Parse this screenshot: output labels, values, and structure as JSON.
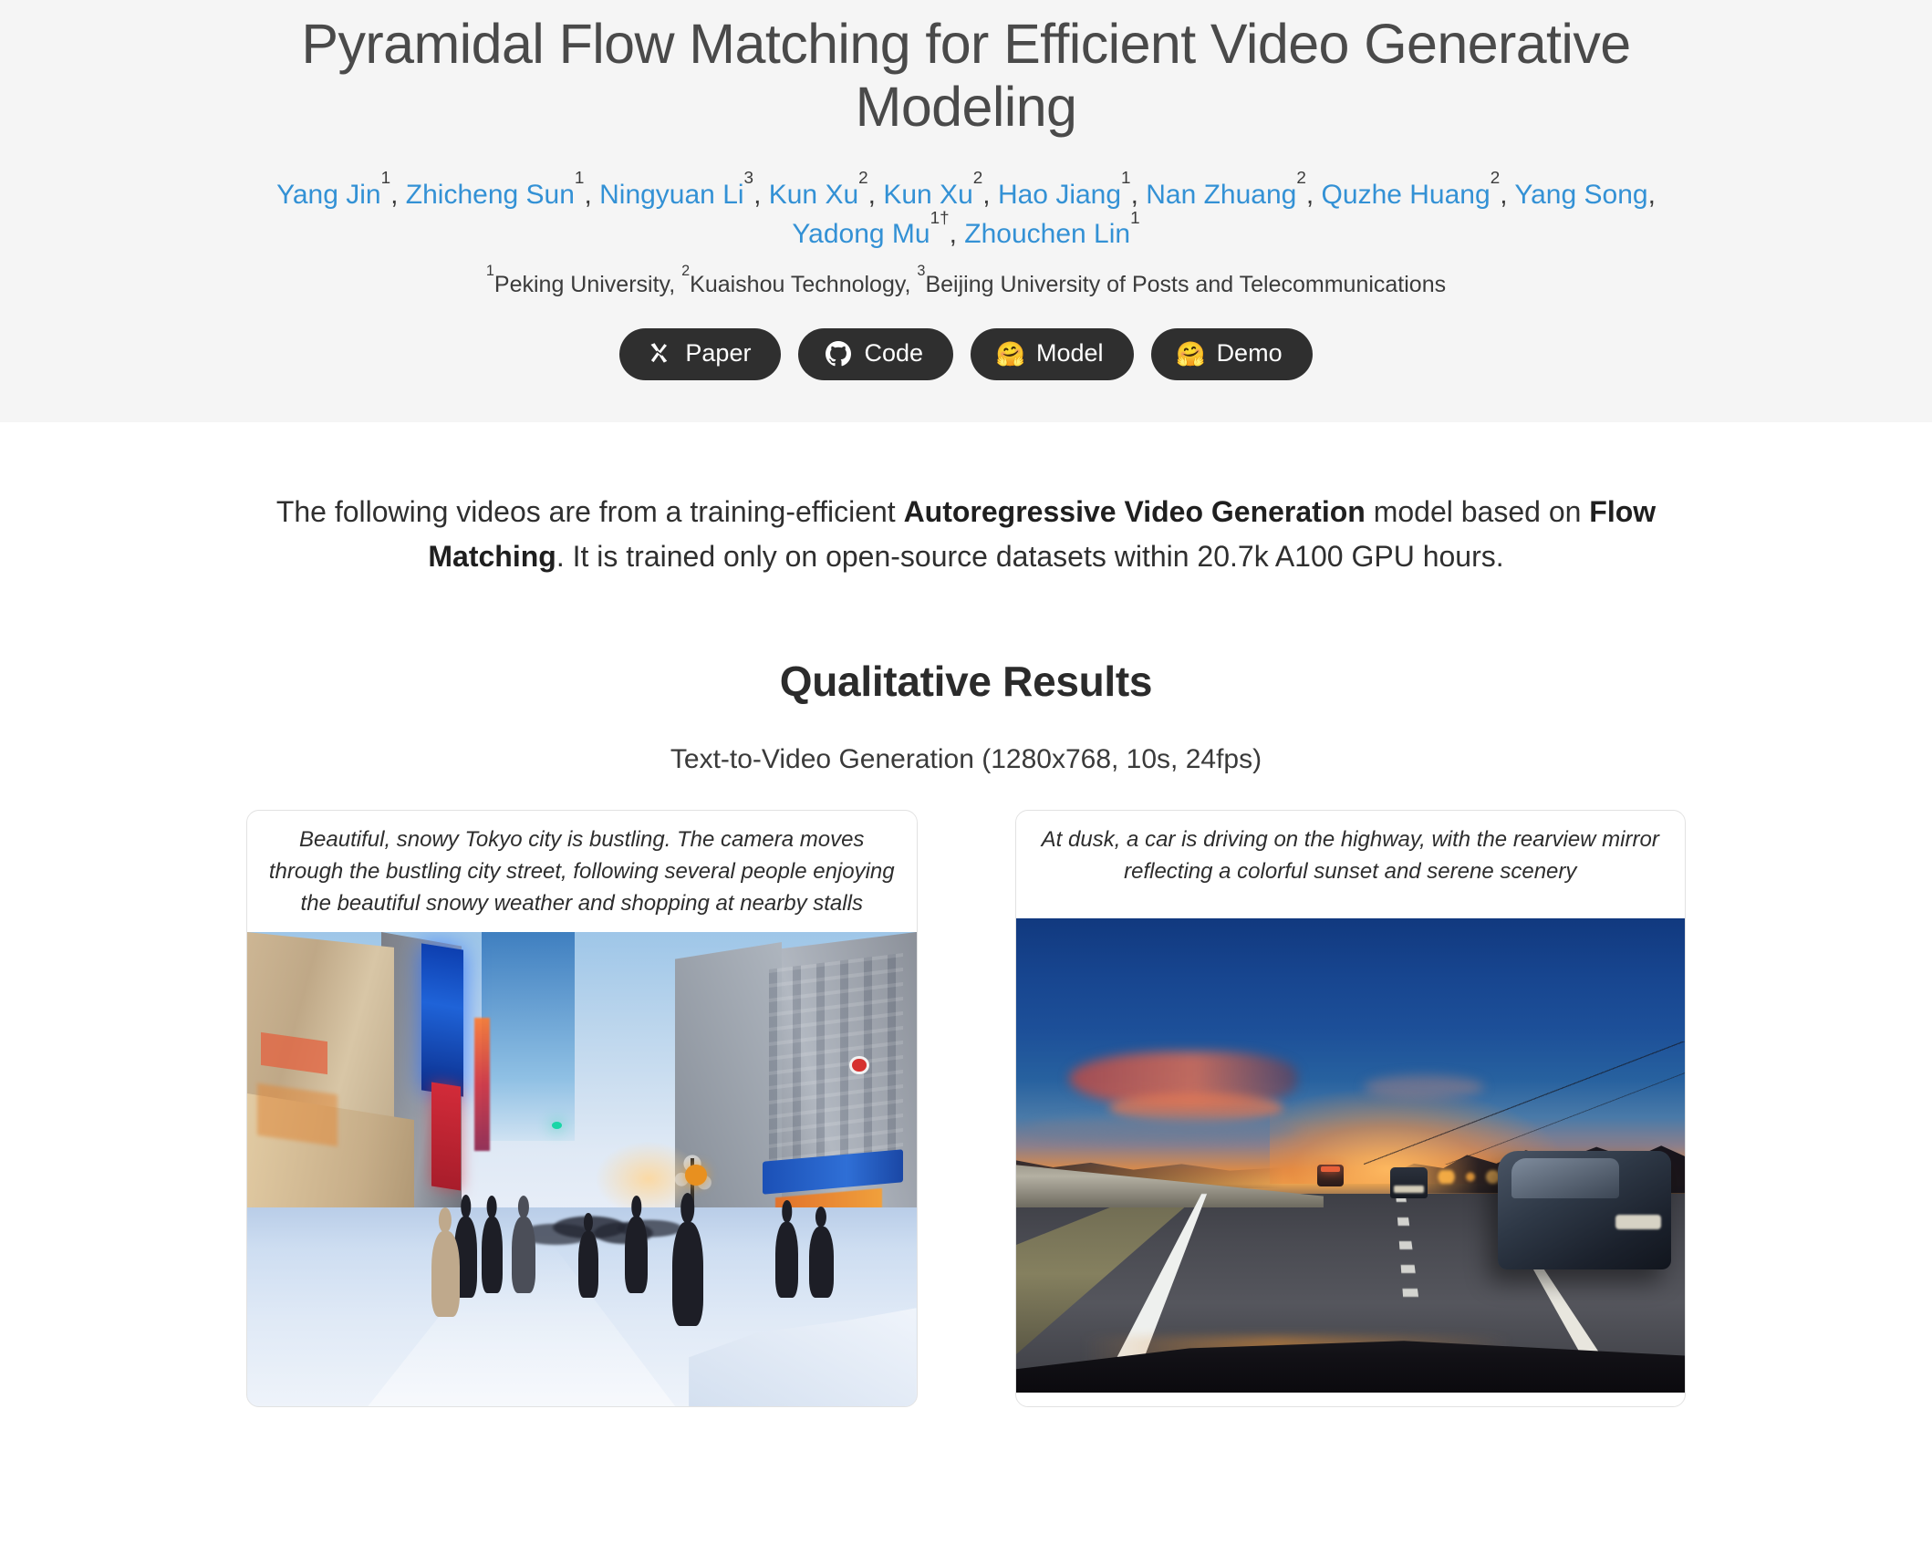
{
  "header": {
    "title": "Pyramidal Flow Matching for Efficient Video Generative Modeling",
    "authors": [
      {
        "name": "Yang Jin",
        "sup": "1"
      },
      {
        "name": "Zhicheng Sun",
        "sup": "1"
      },
      {
        "name": "Ningyuan Li",
        "sup": "3"
      },
      {
        "name": "Kun Xu",
        "sup": "2"
      },
      {
        "name": "Kun Xu",
        "sup": "2"
      },
      {
        "name": "Hao Jiang",
        "sup": "1"
      },
      {
        "name": "Nan Zhuang",
        "sup": "2"
      },
      {
        "name": "Quzhe Huang",
        "sup": "2"
      },
      {
        "name": "Yang Song",
        "sup": ""
      },
      {
        "name": "Yadong Mu",
        "sup": "1†"
      },
      {
        "name": "Zhouchen Lin",
        "sup": "1"
      }
    ],
    "affiliations": [
      {
        "sup": "1",
        "name": "Peking University"
      },
      {
        "sup": "2",
        "name": "Kuaishou Technology"
      },
      {
        "sup": "3",
        "name": "Beijing University of Posts and Telecommunications"
      }
    ],
    "affiliations_separator": ", ",
    "buttons": [
      {
        "label": "Paper",
        "icon": "arxiv-icon"
      },
      {
        "label": "Code",
        "icon": "github-icon"
      },
      {
        "label": "Model",
        "icon": "hugging-face-icon",
        "emoji": "🤗"
      },
      {
        "label": "Demo",
        "icon": "hugging-face-icon",
        "emoji": "🤗"
      }
    ]
  },
  "main": {
    "intro": {
      "part1": "The following videos are from a training-efficient ",
      "bold1": "Autoregressive Video Generation",
      "part2": " model based on ",
      "bold2": "Flow Matching",
      "part3": ". It is trained only on open-source datasets within 20.7k A100 GPU hours."
    },
    "section_title": "Qualitative Results",
    "section_subtitle": "Text-to-Video Generation (1280x768, 10s, 24fps)",
    "videos": [
      {
        "caption": "Beautiful, snowy Tokyo city is bustling. The camera moves through the bustling city street, following several people enjoying the beautiful snowy weather and shopping at nearby stalls",
        "scene": "snowy-tokyo-street"
      },
      {
        "caption": "At dusk, a car is driving on the highway, with the rearview mirror reflecting a colorful sunset and serene scenery",
        "scene": "highway-at-dusk"
      }
    ]
  },
  "theme": {
    "hero_background": "#f5f5f5",
    "page_background": "#ffffff",
    "title_color": "#4a4a4a",
    "author_link_color": "#3391d5",
    "button_background": "#2f2f2f",
    "button_text": "#ffffff",
    "card_border": "#e2e2e2"
  }
}
